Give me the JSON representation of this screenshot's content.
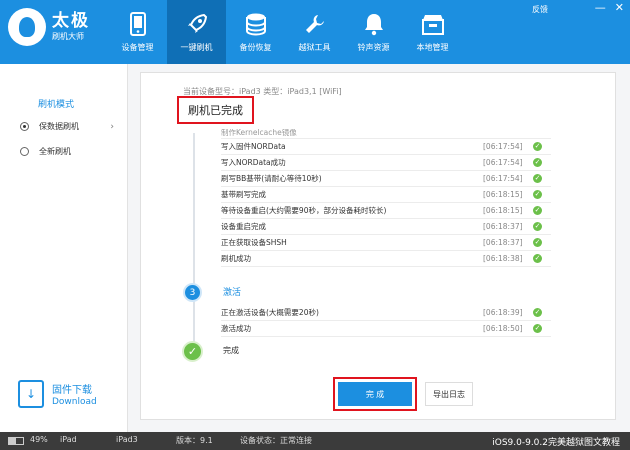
{
  "app": {
    "title": "太极",
    "subtitle": "刷机大师",
    "feedback": "反馈",
    "controls": [
      "—",
      "✕"
    ]
  },
  "nav": [
    {
      "label": "设备管理",
      "icon": "phone-icon"
    },
    {
      "label": "一键刷机",
      "icon": "rocket-icon",
      "active": true
    },
    {
      "label": "备份恢复",
      "icon": "database-icon"
    },
    {
      "label": "越狱工具",
      "icon": "wrench-icon"
    },
    {
      "label": "铃声资源",
      "icon": "bell-icon"
    },
    {
      "label": "本地管理",
      "icon": "box-icon"
    }
  ],
  "sidebar": {
    "mode_title": "刷机模式",
    "items": [
      {
        "label": "保数据刷机",
        "selected": true
      },
      {
        "label": "全新刷机",
        "selected": false
      }
    ],
    "firmware": {
      "label": "固件下载",
      "label_en": "Download"
    }
  },
  "main": {
    "device_info": "当前设备型号：iPad3 类型：iPad3,1 [WiFi]",
    "flash_done": "刷机已完成",
    "log_top_partial": "制作Kernelcache镜像",
    "logs": [
      {
        "text": "写入固件NORData",
        "time": "[06:17:54]"
      },
      {
        "text": "写入NORData成功",
        "time": "[06:17:54]"
      },
      {
        "text": "刷写BB基带(请耐心等待10秒)",
        "time": "[06:17:54]"
      },
      {
        "text": "基带刷写完成",
        "time": "[06:18:15]"
      },
      {
        "text": "等待设备重启(大约需要90秒，部分设备耗时较长)",
        "time": "[06:18:15]"
      },
      {
        "text": "设备重启完成",
        "time": "[06:18:37]"
      },
      {
        "text": "正在获取设备SHSH",
        "time": "[06:18:37]"
      },
      {
        "text": "刷机成功",
        "time": "[06:18:38]"
      }
    ],
    "step3_num": "3",
    "step3_label": "激活",
    "logs2": [
      {
        "text": "正在激活设备(大概需要20秒)",
        "time": "[06:18:39]"
      },
      {
        "text": "激活成功",
        "time": "[06:18:50]"
      }
    ],
    "done_label": "完成",
    "btn_done": "完 成",
    "btn_export": "导出日志"
  },
  "status": {
    "battery_level": 0.49,
    "battery": "49%",
    "device": "iPad",
    "model": "iPad3",
    "version": "版本：9.1",
    "state": "设备状态：正常连接",
    "promo": "iOS9.0-9.0.2完美越狱图文教程"
  },
  "colors": {
    "accent": "#1c8fe0",
    "success": "#6cc04a",
    "highlight": "#e0141e"
  }
}
